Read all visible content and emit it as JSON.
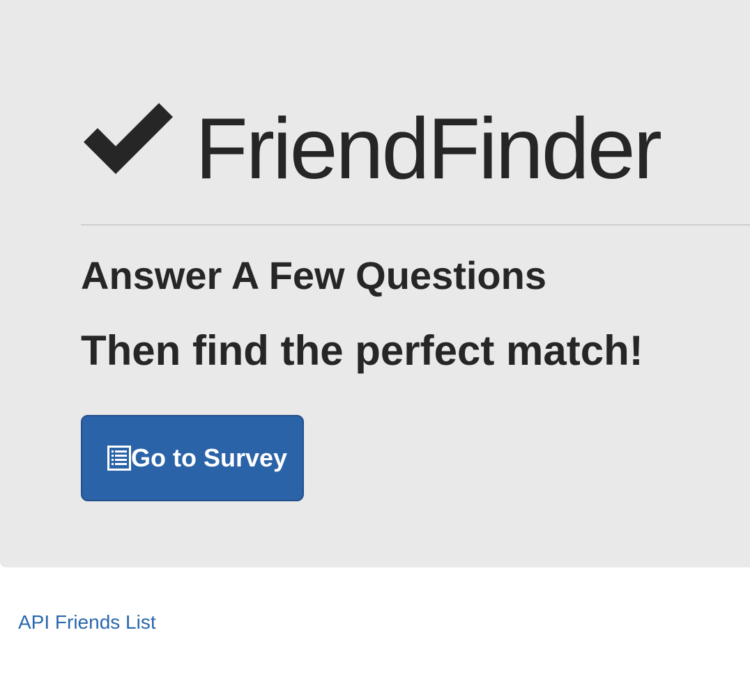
{
  "header": {
    "title": "FriendFinder",
    "title_icon": "checkmark-icon"
  },
  "main": {
    "heading_primary": "Answer A Few Questions",
    "heading_secondary": "Then find the perfect match!",
    "survey_button": {
      "label": "Go to Survey",
      "icon": "list-icon"
    }
  },
  "footer": {
    "api_link_label": "API Friends List"
  },
  "colors": {
    "jumbotron_bg": "#e9e9e9",
    "text": "#262626",
    "button_bg": "#2b63a8",
    "link": "#2a67ad"
  }
}
